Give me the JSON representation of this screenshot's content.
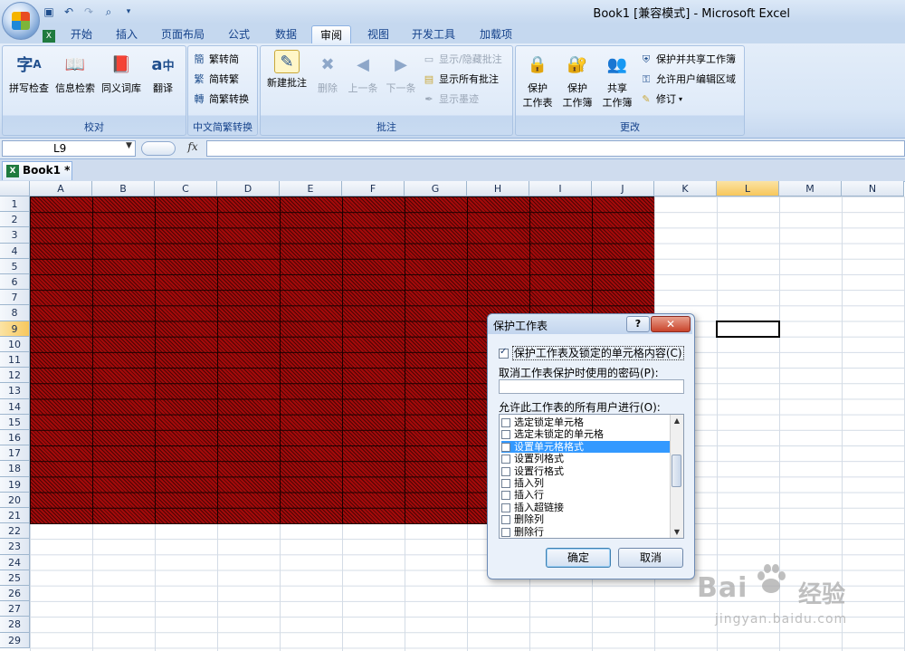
{
  "window": {
    "title": "Book1  [兼容模式] - Microsoft Excel"
  },
  "tabs": [
    {
      "label": "开始"
    },
    {
      "label": "插入"
    },
    {
      "label": "页面布局"
    },
    {
      "label": "公式"
    },
    {
      "label": "数据"
    },
    {
      "label": "审阅"
    },
    {
      "label": "视图"
    },
    {
      "label": "开发工具"
    },
    {
      "label": "加载项"
    }
  ],
  "active_tab": "审阅",
  "ribbon": {
    "proofing": {
      "label": "校对",
      "spell": "拼写检查",
      "research": "信息检索",
      "thesaurus": "同义词库",
      "translate": "翻译"
    },
    "chinese": {
      "label": "中文简繁转换",
      "to_simplified": "繁转简",
      "to_traditional": "简转繁",
      "convert": "简繁转换"
    },
    "comments": {
      "label": "批注",
      "new": "新建批注",
      "delete": "删除",
      "prev": "上一条",
      "next": "下一条",
      "show_hide": "显示/隐藏批注",
      "show_all": "显示所有批注",
      "show_ink": "显示墨迹"
    },
    "changes": {
      "label": "更改",
      "protect_sheet_1": "保护",
      "protect_sheet_2": "工作表",
      "protect_wb_1": "保护",
      "protect_wb_2": "工作簿",
      "share_wb_1": "共享",
      "share_wb_2": "工作簿",
      "protect_share": "保护并共享工作簿",
      "allow_edit": "允许用户编辑区域",
      "track": "修订"
    }
  },
  "formula_bar": {
    "name_box": "L9",
    "fx": "fx",
    "value": ""
  },
  "workbook_tab": {
    "label": "Book1 *"
  },
  "sheet": {
    "columns": [
      "A",
      "B",
      "C",
      "D",
      "E",
      "F",
      "G",
      "H",
      "I",
      "J",
      "K",
      "L",
      "M",
      "N"
    ],
    "rows": [
      "1",
      "2",
      "3",
      "4",
      "5",
      "6",
      "7",
      "8",
      "9",
      "10",
      "11",
      "12",
      "13",
      "14",
      "15",
      "16",
      "17",
      "18",
      "19",
      "20",
      "21",
      "22",
      "23",
      "24",
      "25",
      "26",
      "27",
      "28",
      "29"
    ],
    "selected_cell": "L9",
    "fill_color": "#a40a0a"
  },
  "dialog": {
    "title": "保护工作表",
    "help": "?",
    "close": "✕",
    "protect_label": "保护工作表及锁定的单元格内容(C)",
    "protect_checked": true,
    "password_label": "取消工作表保护时使用的密码(P):",
    "password_value": "",
    "allow_label": "允许此工作表的所有用户进行(O):",
    "permissions": [
      {
        "label": "选定锁定单元格",
        "checked": false
      },
      {
        "label": "选定未锁定的单元格",
        "checked": false
      },
      {
        "label": "设置单元格格式",
        "checked": false,
        "selected": true
      },
      {
        "label": "设置列格式",
        "checked": false
      },
      {
        "label": "设置行格式",
        "checked": false
      },
      {
        "label": "插入列",
        "checked": false
      },
      {
        "label": "插入行",
        "checked": false
      },
      {
        "label": "插入超链接",
        "checked": false
      },
      {
        "label": "删除列",
        "checked": false
      },
      {
        "label": "删除行",
        "checked": false
      }
    ],
    "ok": "确定",
    "cancel": "取消"
  },
  "watermark": {
    "brand": "Bai",
    "brand_cn": "经验",
    "site": "jingyan.baidu.com"
  }
}
